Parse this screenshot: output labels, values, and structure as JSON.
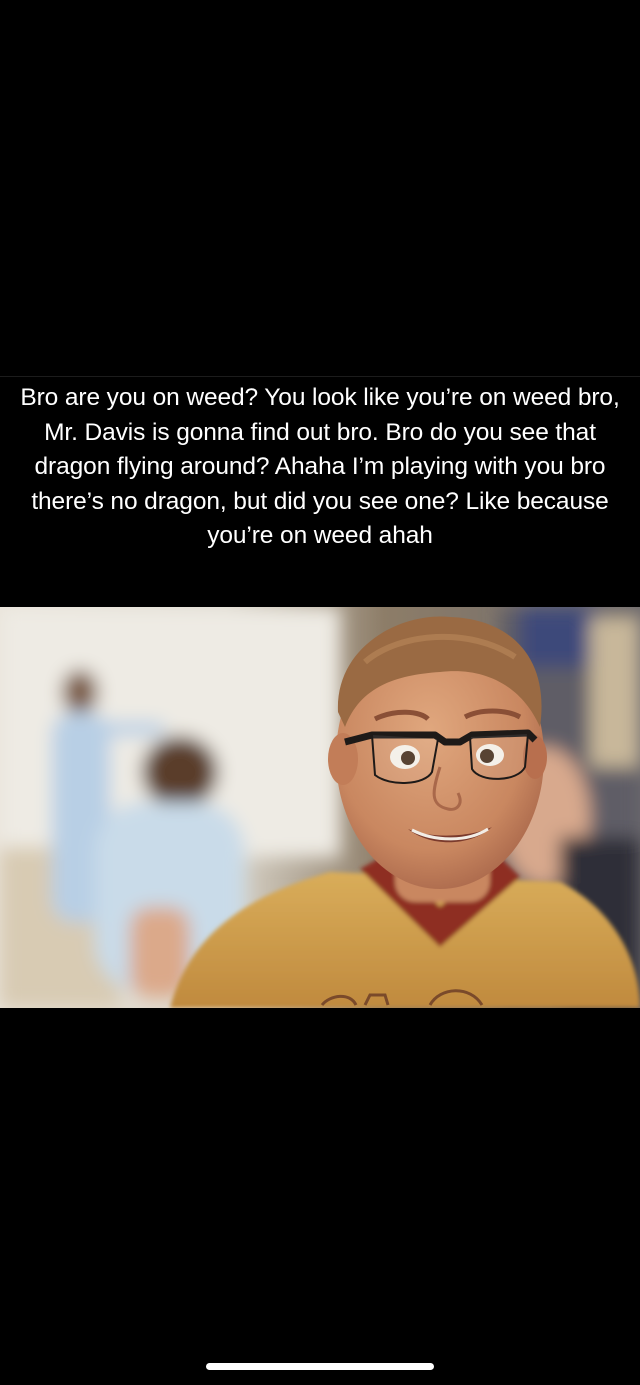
{
  "post": {
    "caption": "Bro are you on weed? You look like you’re on weed bro, Mr. Davis is gonna find out bro. Bro do you see that dragon flying around? Ahaha I’m playing with you bro there’s no dragon, but did you see one? Like because you’re on weed ahah",
    "image_icon": "cartoon-boy-with-glasses-photo"
  },
  "colors": {
    "background": "#000000",
    "caption_text": "#ffffff",
    "home_indicator": "#ffffff"
  },
  "system": {
    "home_indicator_icon": "home-indicator-bar"
  }
}
